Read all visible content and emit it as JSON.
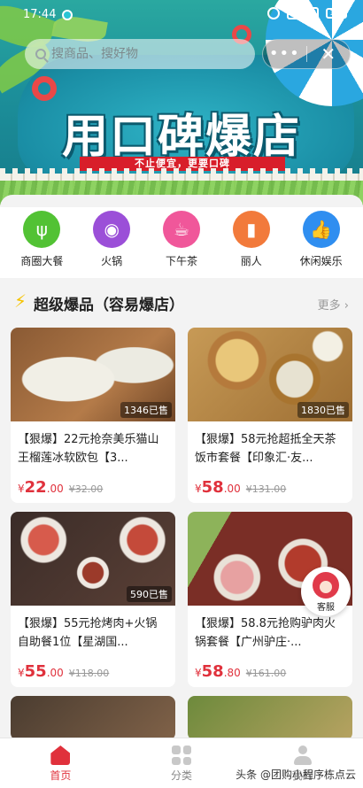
{
  "status_bar": {
    "time": "17:44",
    "battery": "100"
  },
  "search": {
    "placeholder": "搜商品、搜好物"
  },
  "capsule": {
    "more": "•••",
    "close": "✕"
  },
  "banner": {
    "title": "用口碑爆店",
    "subtitle": "不止便宜，更要口碑"
  },
  "categories": [
    {
      "label": "商圈大餐",
      "icon": "utensils-icon",
      "color": "#52c234"
    },
    {
      "label": "火锅",
      "icon": "hotpot-icon",
      "color": "#9b4fd8"
    },
    {
      "label": "下午茶",
      "icon": "drink-icon",
      "color": "#f0579a"
    },
    {
      "label": "丽人",
      "icon": "lipstick-icon",
      "color": "#f27a3b"
    },
    {
      "label": "休闲娱乐",
      "icon": "thumbs-up-icon",
      "color": "#2f8ef0"
    }
  ],
  "section": {
    "title": "超级爆品（容易爆店）",
    "more": "更多"
  },
  "products": [
    {
      "name": "【狠爆】22元抢奈美乐猫山王榴莲冰软欧包【3...",
      "sold": "1346已售",
      "yen": "¥",
      "price_int": "22",
      "price_dec": ".00",
      "orig": "¥32.00"
    },
    {
      "name": "【狠爆】58元抢超抵全天茶饭市套餐【印象汇·友...",
      "sold": "1830已售",
      "yen": "¥",
      "price_int": "58",
      "price_dec": ".00",
      "orig": "¥131.00"
    },
    {
      "name": "【狠爆】55元抢烤肉+火锅自助餐1位【星湖国...",
      "sold": "590已售",
      "yen": "¥",
      "price_int": "55",
      "price_dec": ".00",
      "orig": "¥118.00"
    },
    {
      "name": "【狠爆】58.8元抢购驴肉火锅套餐【广州驴庄·...",
      "sold": "",
      "yen": "¥",
      "price_int": "58",
      "price_dec": ".80",
      "orig": "¥161.00"
    }
  ],
  "service": {
    "label": "客服"
  },
  "tabs": [
    {
      "label": "首页",
      "icon": "home-icon"
    },
    {
      "label": "分类",
      "icon": "category-grid-icon"
    },
    {
      "label": "我的",
      "icon": "user-icon"
    }
  ],
  "watermark": "头条 @团购小程序栋点云",
  "colors": {
    "accent": "#e0313c"
  }
}
